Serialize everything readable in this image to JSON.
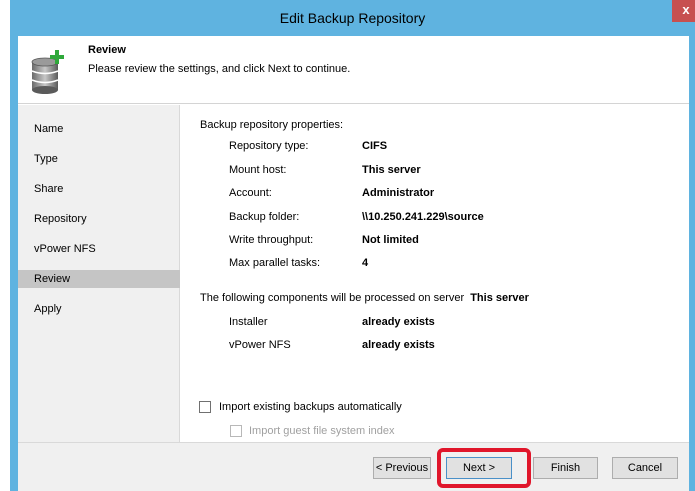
{
  "window": {
    "title": "Edit Backup Repository",
    "close_label": "x"
  },
  "header": {
    "title": "Review",
    "subtitle": "Please review the settings, and click Next to continue.",
    "icon": "database-add-icon"
  },
  "sidebar": {
    "items": [
      {
        "label": "Name",
        "active": false
      },
      {
        "label": "Type",
        "active": false
      },
      {
        "label": "Share",
        "active": false
      },
      {
        "label": "Repository",
        "active": false
      },
      {
        "label": "vPower NFS",
        "active": false
      },
      {
        "label": "Review",
        "active": true
      },
      {
        "label": "Apply",
        "active": false
      }
    ]
  },
  "properties": {
    "heading": "Backup repository properties:",
    "rows": [
      {
        "label": "Repository type:",
        "value": "CIFS"
      },
      {
        "label": "Mount host:",
        "value": "This server"
      },
      {
        "label": "Account:",
        "value": "Administrator"
      },
      {
        "label": "Backup folder:",
        "value": "\\\\10.250.241.229\\source"
      },
      {
        "label": "Write throughput:",
        "value": "Not limited"
      },
      {
        "label": "Max parallel tasks:",
        "value": "4"
      }
    ]
  },
  "components": {
    "heading": "The following components will be processed on server",
    "server": "This server",
    "rows": [
      {
        "label": "Installer",
        "value": "already exists"
      },
      {
        "label": "vPower NFS",
        "value": "already exists"
      }
    ]
  },
  "options": {
    "import_backups": "Import existing backups automatically",
    "import_guest_index": "Import guest file system index"
  },
  "buttons": {
    "previous": "< Previous",
    "next": "Next >",
    "finish": "Finish",
    "cancel": "Cancel"
  },
  "colors": {
    "titlebar": "#5fb3e0",
    "highlight": "#e0162b",
    "close": "#c75050"
  }
}
